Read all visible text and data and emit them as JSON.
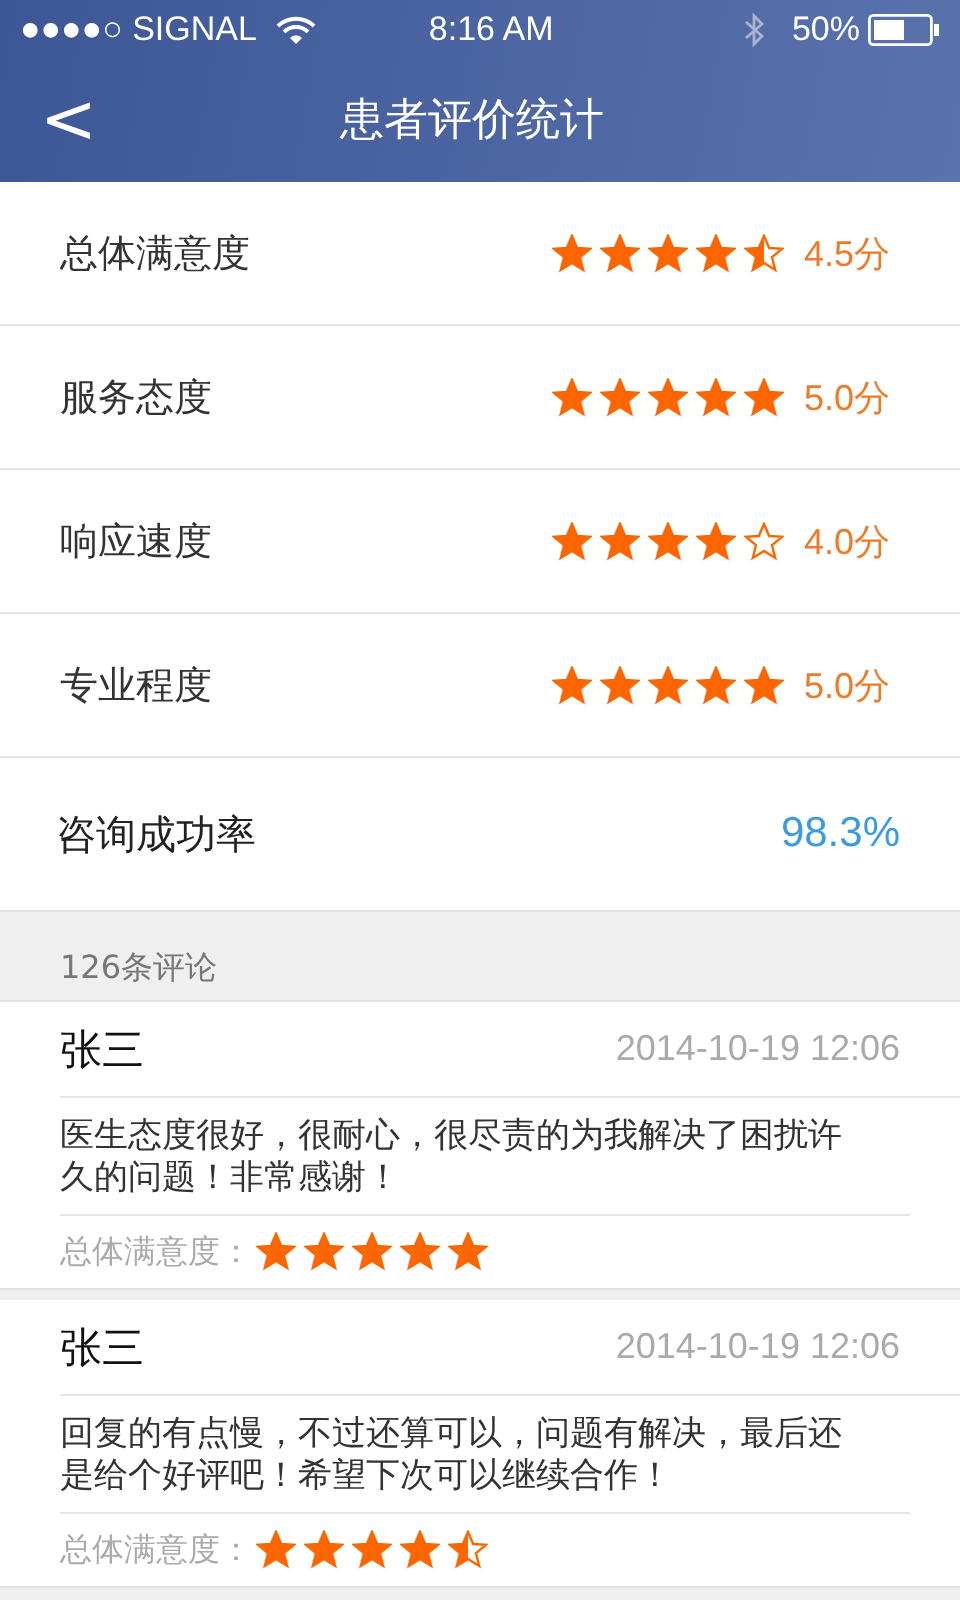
{
  "status_bar": {
    "carrier": "●●●●○ SIGNAL",
    "time": "8:16 AM",
    "battery": "50%"
  },
  "nav": {
    "back": "<",
    "title": "患者评价统计"
  },
  "ratings": [
    {
      "label": "总体满意度",
      "stars": 4.5,
      "score": "4.5分"
    },
    {
      "label": "服务态度",
      "stars": 5,
      "score": "5.0分"
    },
    {
      "label": "响应速度",
      "stars": 4,
      "score": "4.0分"
    },
    {
      "label": "专业程度",
      "stars": 5,
      "score": "5.0分"
    }
  ],
  "success": {
    "label": "咨询成功率",
    "value": "98.3%"
  },
  "comments_header": "126条评论",
  "comments": [
    {
      "name": "张三",
      "time": "2014-10-19 12:06",
      "text": "医生态度很好，很耐心，很尽责的为我解决了困扰许久的问题！非常感谢！",
      "rating_label": "总体满意度：",
      "stars": 5
    },
    {
      "name": "张三",
      "time": "2014-10-19 12:06",
      "text": "回复的有点慢，不过还算可以，问题有解决，最后还是给个好评吧！希望下次可以继续合作！",
      "rating_label": "总体满意度：",
      "stars": 4.5
    }
  ]
}
